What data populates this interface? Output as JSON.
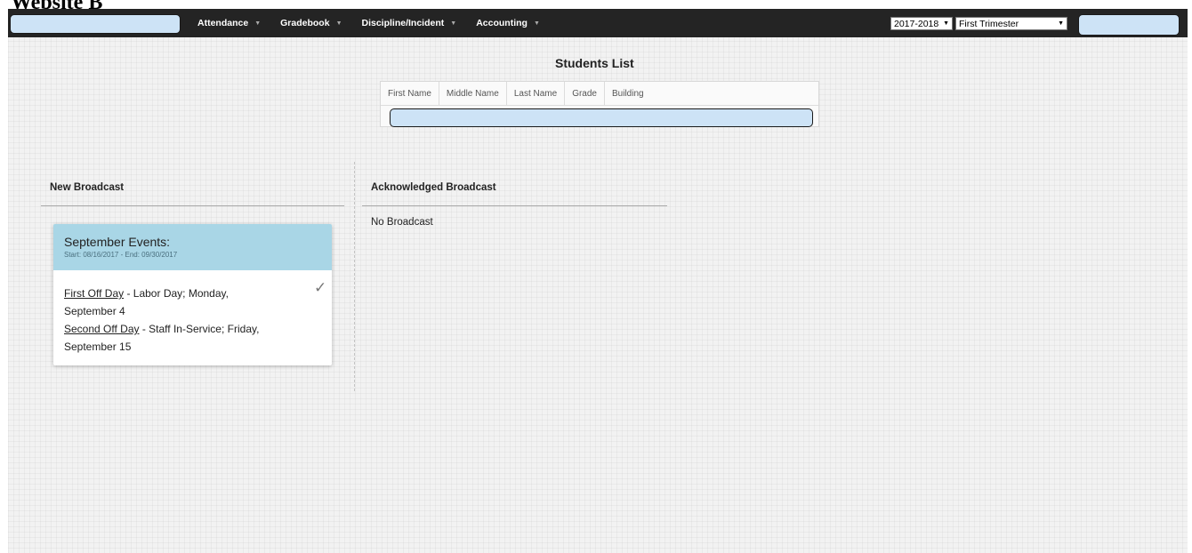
{
  "caption": "Website B",
  "nav": {
    "items": [
      {
        "label": "Attendance"
      },
      {
        "label": "Gradebook"
      },
      {
        "label": "Discipline/Incident"
      },
      {
        "label": "Accounting"
      }
    ],
    "school_year": "2017-2018",
    "term": "First Trimester"
  },
  "students": {
    "title": "Students List",
    "columns": [
      "First Name",
      "Middle Name",
      "Last Name",
      "Grade",
      "Building"
    ]
  },
  "new_broadcast": {
    "title": "New Broadcast",
    "card": {
      "title": "September Events:",
      "dates": "Start: 08/16/2017 - End: 09/30/2017",
      "items": [
        {
          "name": "First Off Day",
          "detail": " - Labor Day; Monday, September 4"
        },
        {
          "name": "Second Off Day",
          "detail": " - Staff In-Service; Friday, September 15"
        }
      ]
    }
  },
  "acknowledged_broadcast": {
    "title": "Acknowledged Broadcast",
    "empty_text": "No Broadcast"
  },
  "icons": {
    "check": "checkmark-icon",
    "caret": "caret-down-icon"
  },
  "colors": {
    "topbar": "#242424",
    "card_header": "#a9d6e6",
    "redaction": "#cde3f6"
  }
}
